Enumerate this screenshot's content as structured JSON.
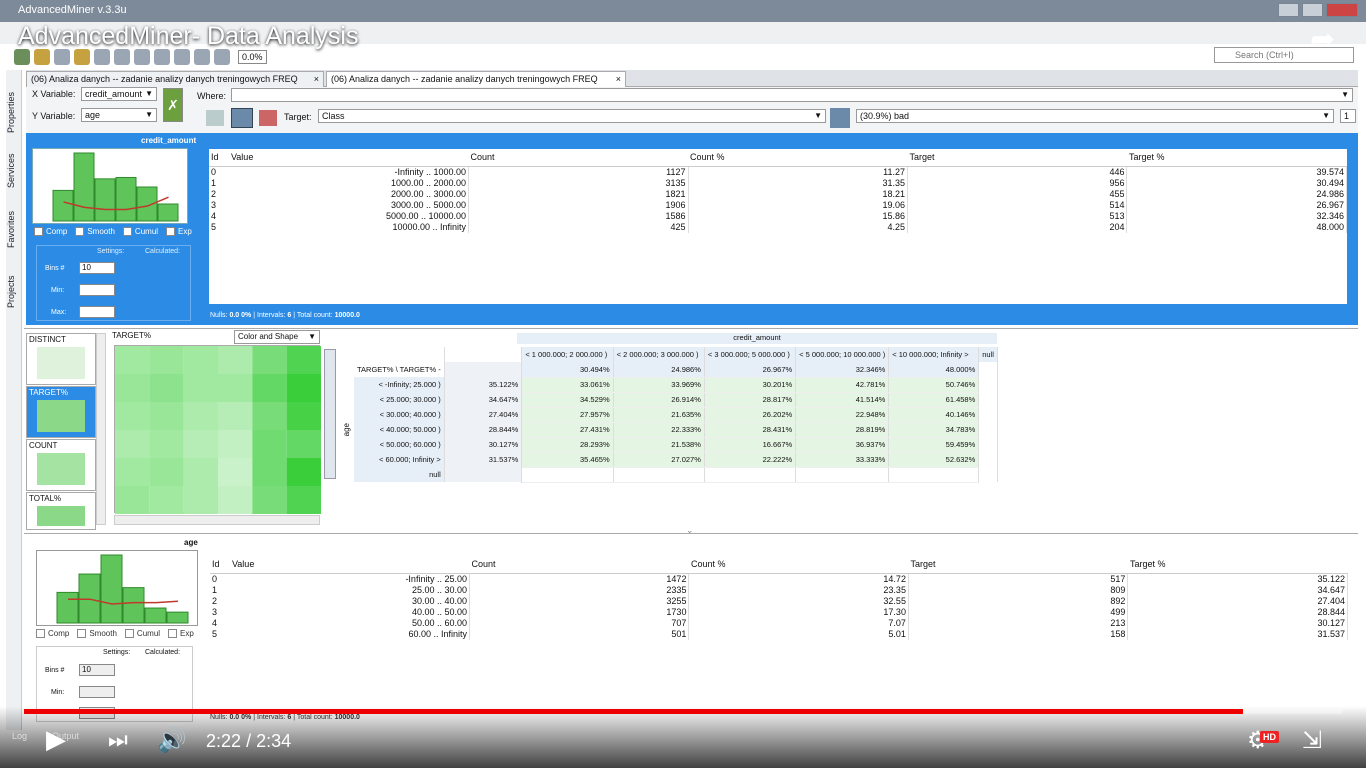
{
  "window": {
    "title": "AdvancedMiner v.3.3u"
  },
  "video": {
    "title": "AdvancedMiner- Data Analysis",
    "time_current": "2:22",
    "time_total": "2:34",
    "time_sep": "/",
    "progress_fraction": 0.925,
    "hd_badge": "HD"
  },
  "toolbar": {
    "zoom": "0.0%",
    "search_placeholder": "Search (Ctrl+I)"
  },
  "sidebar": {
    "items": [
      "Properties",
      "Services",
      "Favorites",
      "Projects"
    ]
  },
  "tabs": [
    "(06) Analiza danych -- zadanie analizy danych treningowych FREQ",
    "(06) Analiza danych -- zadanie analizy danych treningowych FREQ"
  ],
  "controls": {
    "x_label": "X Variable:",
    "x_value": "credit_amount",
    "y_label": "Y Variable:",
    "y_value": "age",
    "where_label": "Where:",
    "target_label": "Target:",
    "target_value": "Class",
    "target_class": "(30.9%) bad",
    "target_num": "1"
  },
  "top_panel": {
    "title": "credit_amount",
    "checks": [
      "Comp",
      "Smooth",
      "Cumul",
      "Exp"
    ],
    "settings": "Settings:",
    "calculated": "Calculated:",
    "bins_label": "Bins #",
    "bins_value": "10",
    "min_label": "Min:",
    "max_label": "Max:",
    "headers": [
      "Id",
      "Value",
      "Count",
      "Count %",
      "Target",
      "Target %"
    ],
    "rows": [
      [
        "0",
        "-Infinity  ..  1000.00",
        "1127",
        "11.27",
        "446",
        "39.574"
      ],
      [
        "1",
        "1000.00  ..  2000.00",
        "3135",
        "31.35",
        "956",
        "30.494"
      ],
      [
        "2",
        "2000.00  ..  3000.00",
        "1821",
        "18.21",
        "455",
        "24.986"
      ],
      [
        "3",
        "3000.00  ..  5000.00",
        "1906",
        "19.06",
        "514",
        "26.967"
      ],
      [
        "4",
        "5000.00  ..  10000.00",
        "1586",
        "15.86",
        "513",
        "32.346"
      ],
      [
        "5",
        "10000.00  ..  Infinity",
        "425",
        "4.25",
        "204",
        "48.000"
      ]
    ],
    "status": {
      "nulls": "Nulls:",
      "nulls_v": "0.0",
      "pct": "0%",
      "intervals": "Intervals:",
      "intervals_v": "6",
      "total": "Total count:",
      "total_v": "10000.0"
    }
  },
  "mid_panel": {
    "thumbs": [
      "DISTINCT",
      "TARGET%",
      "COUNT",
      "TOTAL%"
    ],
    "heatmap_title": "TARGET%",
    "heatmap_mode": "Color and Shape",
    "cross_title": "credit_amount",
    "row_axis": "age",
    "corner": "TARGET% \\ TARGET% -",
    "col_headers": [
      "< 1 000.000; 2 000.000 )",
      "< 2 000.000; 3 000.000 )",
      "< 3 000.000; 5 000.000 )",
      "< 5 000.000; 10 000.000 )",
      "< 10 000.000; Infinity >",
      "null"
    ],
    "rows": [
      {
        "label": "",
        "total": "",
        "vals": [
          "30.494%",
          "24.986%",
          "26.967%",
          "32.346%",
          "48.000%"
        ]
      },
      {
        "label": "< -Infinity; 25.000 )",
        "total": "35.122%",
        "vals": [
          "33.061%",
          "33.969%",
          "30.201%",
          "42.781%",
          "50.746%"
        ]
      },
      {
        "label": "< 25.000; 30.000 )",
        "total": "34.647%",
        "vals": [
          "34.529%",
          "26.914%",
          "28.817%",
          "41.514%",
          "61.458%"
        ]
      },
      {
        "label": "< 30.000; 40.000 )",
        "total": "27.404%",
        "vals": [
          "27.957%",
          "21.635%",
          "26.202%",
          "22.948%",
          "40.146%"
        ]
      },
      {
        "label": "< 40.000; 50.000 )",
        "total": "28.844%",
        "vals": [
          "27.431%",
          "22.333%",
          "28.431%",
          "28.819%",
          "34.783%"
        ]
      },
      {
        "label": "< 50.000; 60.000 )",
        "total": "30.127%",
        "vals": [
          "28.293%",
          "21.538%",
          "16.667%",
          "36.937%",
          "59.459%"
        ]
      },
      {
        "label": "< 60.000; Infinity >",
        "total": "31.537%",
        "vals": [
          "35.465%",
          "27.027%",
          "22.222%",
          "33.333%",
          "52.632%"
        ]
      },
      {
        "label": "null",
        "total": "",
        "vals": [
          "",
          "",
          "",
          "",
          ""
        ]
      }
    ],
    "heat": [
      [
        0.3,
        0.35,
        0.3,
        0.25,
        0.5,
        0.7
      ],
      [
        0.35,
        0.4,
        0.3,
        0.3,
        0.6,
        0.8
      ],
      [
        0.3,
        0.35,
        0.25,
        0.2,
        0.5,
        0.75
      ],
      [
        0.25,
        0.3,
        0.2,
        0.15,
        0.55,
        0.6
      ],
      [
        0.3,
        0.35,
        0.25,
        0.1,
        0.55,
        0.8
      ],
      [
        0.35,
        0.3,
        0.25,
        0.15,
        0.5,
        0.7
      ]
    ]
  },
  "bottom_panel": {
    "title": "age",
    "headers": [
      "Id",
      "Value",
      "Count",
      "Count %",
      "Target",
      "Target %"
    ],
    "rows": [
      [
        "0",
        "-Infinity  ..  25.00",
        "1472",
        "14.72",
        "517",
        "35.122"
      ],
      [
        "1",
        "25.00  ..  30.00",
        "2335",
        "23.35",
        "809",
        "34.647"
      ],
      [
        "2",
        "30.00  ..  40.00",
        "3255",
        "32.55",
        "892",
        "27.404"
      ],
      [
        "3",
        "40.00  ..  50.00",
        "1730",
        "17.30",
        "499",
        "28.844"
      ],
      [
        "4",
        "50.00  ..  60.00",
        "707",
        "7.07",
        "213",
        "30.127"
      ],
      [
        "5",
        "60.00  ..  Infinity",
        "501",
        "5.01",
        "158",
        "31.537"
      ]
    ],
    "bins_value": "10"
  },
  "bottom_bar": {
    "log": "Log",
    "output": "Output"
  },
  "hist_top": {
    "bars": [
      0.45,
      1.0,
      0.62,
      0.64,
      0.5,
      0.25
    ],
    "line": [
      0.28,
      0.2,
      0.17,
      0.17,
      0.22,
      0.35
    ]
  },
  "hist_bot": {
    "bars": [
      0.45,
      0.72,
      1.0,
      0.52,
      0.22,
      0.16
    ],
    "line": [
      0.35,
      0.35,
      0.28,
      0.3,
      0.3,
      0.32
    ]
  }
}
